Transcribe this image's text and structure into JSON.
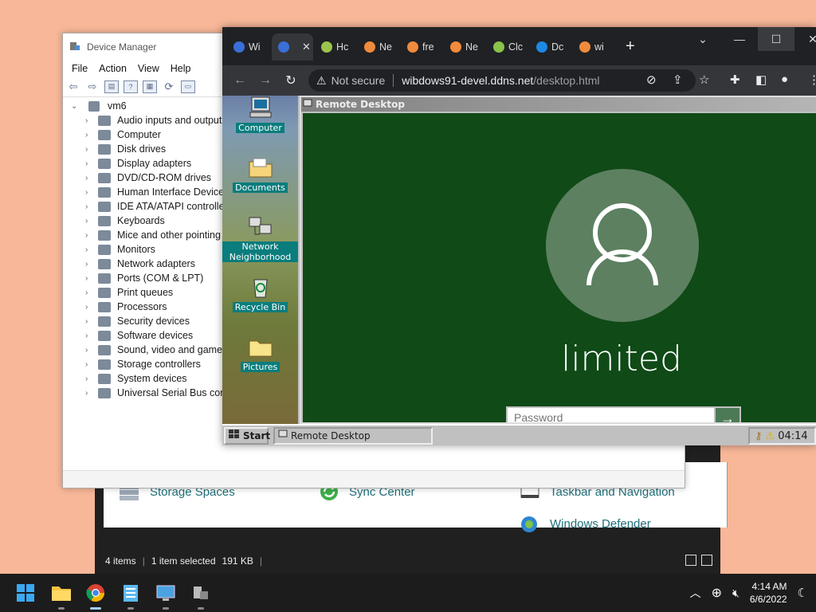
{
  "explorer": {
    "items": [
      {
        "label": "Storage Spaces",
        "icon": "storage-spaces-icon"
      },
      {
        "label": "Sync Center",
        "icon": "sync-center-icon"
      },
      {
        "label": "Taskbar and Navigation",
        "icon": "taskbar-navigation-icon"
      },
      {
        "label": "Windows Defender",
        "icon": "windows-defender-icon"
      }
    ],
    "status": {
      "items": "4 items",
      "selected": "1 item selected",
      "size": "191 KB"
    }
  },
  "device_manager": {
    "title": "Device Manager",
    "menu": [
      "File",
      "Action",
      "View",
      "Help"
    ],
    "root": "vm6",
    "categories": [
      "Audio inputs and outputs",
      "Computer",
      "Disk drives",
      "Display adapters",
      "DVD/CD-ROM drives",
      "Human Interface Devices",
      "IDE ATA/ATAPI controllers",
      "Keyboards",
      "Mice and other pointing devices",
      "Monitors",
      "Network adapters",
      "Ports (COM & LPT)",
      "Print queues",
      "Processors",
      "Security devices",
      "Software devices",
      "Sound, video and game controllers",
      "Storage controllers",
      "System devices",
      "Universal Serial Bus controllers"
    ]
  },
  "browser": {
    "tabs": [
      {
        "label": "Wi",
        "color": "#3a6fd8",
        "active": false
      },
      {
        "label": "",
        "color": "#3a6fd8",
        "active": true
      },
      {
        "label": "Hc",
        "color": "#9bc44c",
        "active": false
      },
      {
        "label": "Ne",
        "color": "#f08a3c",
        "active": false
      },
      {
        "label": "fre",
        "color": "#f08a3c",
        "active": false
      },
      {
        "label": "Ne",
        "color": "#f08a3c",
        "active": false
      },
      {
        "label": "Clc",
        "color": "#8ac24a",
        "active": false
      },
      {
        "label": "Dc",
        "color": "#1e88e5",
        "active": false
      },
      {
        "label": "wi",
        "color": "#f08a3c",
        "active": false
      }
    ],
    "new_tab": "+",
    "security_label": "Not secure",
    "url_host": "wibdows91-devel.ddns.net",
    "url_path": "/desktop.html"
  },
  "remote": {
    "desktop_icons": [
      {
        "label": "Computer",
        "icon": "my-computer-icon"
      },
      {
        "label": "Documents",
        "icon": "documents-folder-icon"
      },
      {
        "label": "Network Neighborhood",
        "icon": "network-neighborhood-icon"
      },
      {
        "label": "Recycle Bin",
        "icon": "recycle-bin-icon"
      },
      {
        "label": "Pictures",
        "icon": "pictures-folder-icon"
      }
    ],
    "window_title": "Remote Desktop",
    "login": {
      "username": "limited",
      "password_placeholder": "Password",
      "submit": "→"
    },
    "taskbar": {
      "start": "Start",
      "task": "Remote Desktop",
      "time": "04:14"
    }
  },
  "taskbar": {
    "apps": [
      "start-icon",
      "file-explorer-icon",
      "chrome-icon",
      "notepad-icon",
      "remote-desktop-icon",
      "device-manager-icon"
    ],
    "time": "4:14 AM",
    "date": "6/6/2022"
  }
}
